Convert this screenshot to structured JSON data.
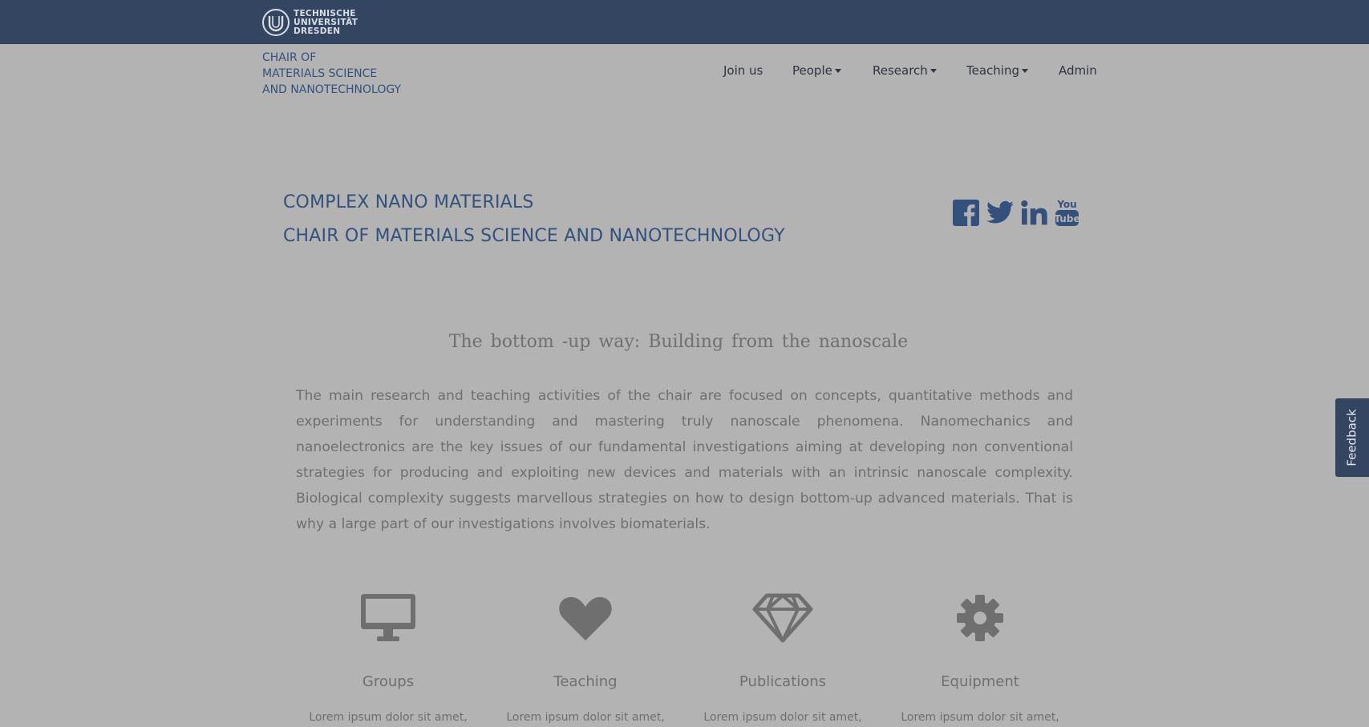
{
  "brand": {
    "logo_lines": [
      "TECHNISCHE",
      "UNIVERSITÄT",
      "DRESDEN"
    ],
    "chair_lines": [
      "CHAIR OF",
      "MATERIALS SCIENCE",
      "AND NANOTECHNOLOGY"
    ]
  },
  "nav": {
    "join": "Join us",
    "people": "People",
    "research": "Research",
    "teaching": "Teaching",
    "admin": "Admin"
  },
  "hero": {
    "line1": "COMPLEX NANO MATERIALS",
    "line2": "CHAIR OF MATERIALS SCIENCE AND NANOTECHNOLOGY"
  },
  "social": [
    "facebook-icon",
    "twitter-icon",
    "linkedin-icon",
    "youtube-icon"
  ],
  "tagline": "The bottom -up way: Building from the nanoscale",
  "intro": "The main research and teaching activities of the chair are focused on concepts, quantitative methods and experiments for understanding and mastering truly nanoscale phenomena. Nanomechanics and nanoelectronics are the key issues of our fundamental investigations aiming at developing non conventional strategies for producing and exploiting new devices and materials with an intrinsic nanoscale complexity. Biological complexity suggests marvellous strategies on how to design bottom-up advanced materials. That is why a large part of our investigations involves biomaterials.",
  "features": [
    {
      "title": "Groups",
      "desc": "Lorem ipsum dolor sit amet,",
      "icon": "desktop-icon"
    },
    {
      "title": "Teaching",
      "desc": "Lorem ipsum dolor sit amet,",
      "icon": "heart-icon"
    },
    {
      "title": "Publications",
      "desc": "Lorem ipsum dolor sit amet,",
      "icon": "diamond-icon"
    },
    {
      "title": "Equipment",
      "desc": "Lorem ipsum dolor sit amet,",
      "icon": "gear-icon"
    }
  ],
  "feedback": "Feedback",
  "colors": {
    "topbar": "#334560",
    "overlay_bg": "#b3b3b3",
    "brand_text": "#34507c"
  }
}
